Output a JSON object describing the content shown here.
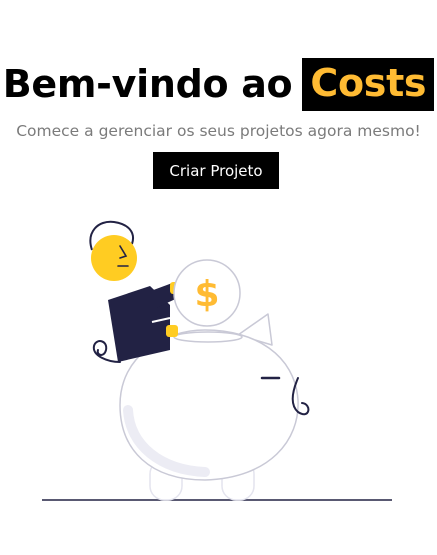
{
  "hero": {
    "title_prefix": "Bem-vindo ao",
    "title_highlight": "Costs",
    "subtitle": "Comece a gerenciar os seus projetos agora mesmo!"
  },
  "cta": {
    "label": "Criar Projeto"
  },
  "illustration": {
    "coin_symbol": "$",
    "icon": "piggy-bank-savings-illustration"
  },
  "colors": {
    "accent": "#ffbb33",
    "primary": "#000000",
    "navy": "#222244",
    "subtitle": "#7b7b7b"
  }
}
